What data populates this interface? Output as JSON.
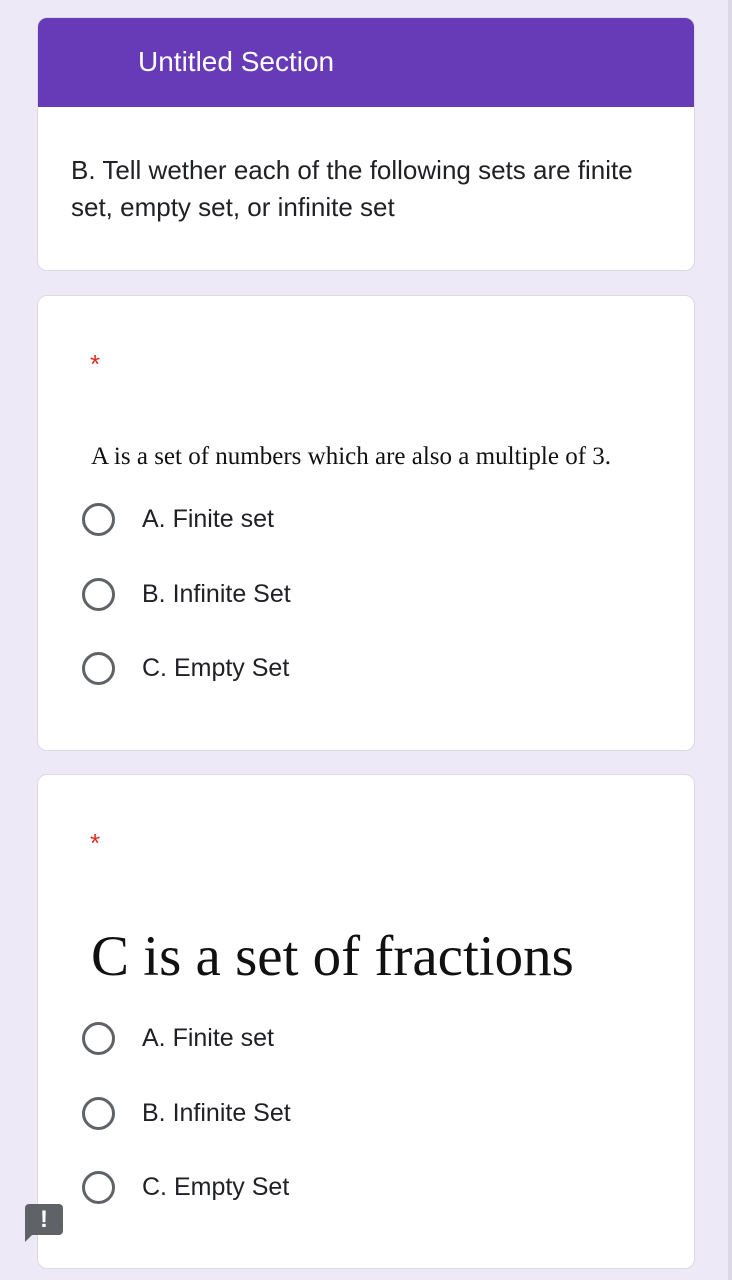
{
  "section": {
    "title": "Untitled Section",
    "description": "B. Tell wether each of the following sets are finite set, empty set, or infinite set",
    "header_color": "#673ab7"
  },
  "questions": [
    {
      "required_mark": "*",
      "image_text": "A is a set of numbers which are also a multiple of 3.",
      "options": [
        {
          "label": "A. Finite set",
          "selected": false
        },
        {
          "label": "B. Infinite Set",
          "selected": false
        },
        {
          "label": "C. Empty Set",
          "selected": false
        }
      ]
    },
    {
      "required_mark": "*",
      "image_text": "C is a set of fractions",
      "options": [
        {
          "label": "A. Finite set",
          "selected": false
        },
        {
          "label": "B. Infinite Set",
          "selected": false
        },
        {
          "label": "C. Empty Set",
          "selected": false
        }
      ]
    }
  ],
  "report_button": {
    "icon": "report-problem-icon",
    "glyph": "!"
  },
  "colors": {
    "background": "#ede9f6",
    "required": "#d93025",
    "radio": "#5f6368"
  }
}
